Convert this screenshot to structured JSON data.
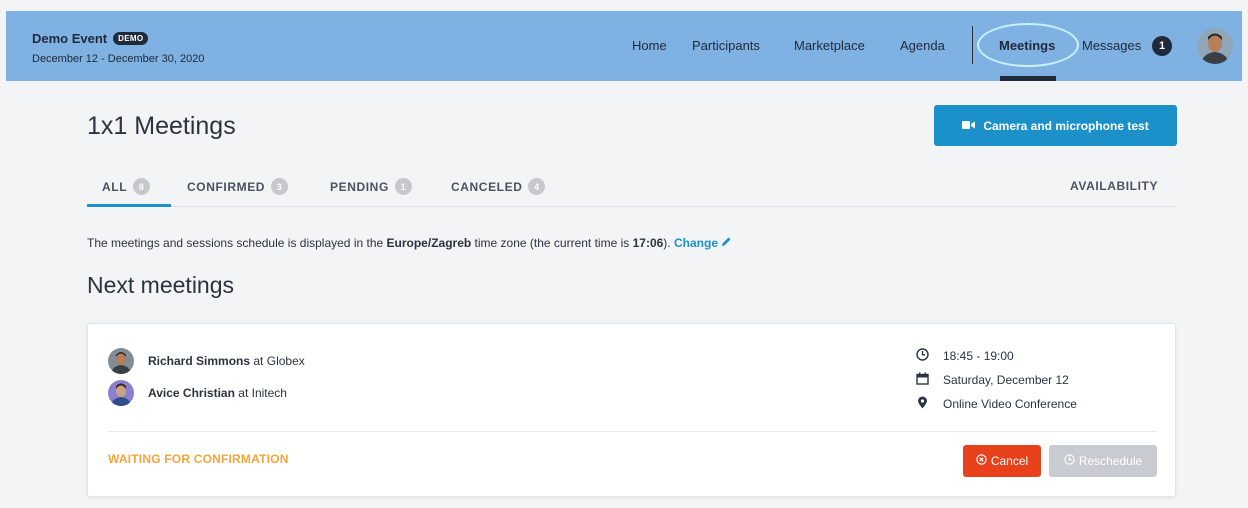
{
  "event": {
    "name": "Demo Event",
    "badge": "DEMO",
    "dates": "December 12 - December 30, 2020"
  },
  "nav": {
    "home": "Home",
    "participants": "Participants",
    "marketplace": "Marketplace",
    "agenda": "Agenda",
    "meetings": "Meetings",
    "messages": "Messages",
    "messages_count": "1"
  },
  "page": {
    "title": "1x1 Meetings",
    "camera_button": "Camera and microphone test"
  },
  "tabs": [
    {
      "label": "ALL",
      "count": "8"
    },
    {
      "label": "CONFIRMED",
      "count": "3"
    },
    {
      "label": "PENDING",
      "count": "1"
    },
    {
      "label": "CANCELED",
      "count": "4"
    }
  ],
  "availability": "AVAILABILITY",
  "timezone": {
    "prefix": "The meetings and sessions schedule is displayed in the ",
    "zone": "Europe/Zagreb",
    "middle": " time zone (the current time is ",
    "time": "17:06",
    "suffix": ").",
    "change": "Change"
  },
  "section_title": "Next meetings",
  "meeting": {
    "participants": [
      {
        "name": "Richard Simmons",
        "at": "at",
        "company": "Globex"
      },
      {
        "name": "Avice Christian",
        "at": "at",
        "company": "Initech"
      }
    ],
    "time": "18:45 - 19:00",
    "date": "Saturday, December 12",
    "location": "Online Video Conference",
    "status": "WAITING FOR CONFIRMATION",
    "cancel": "Cancel",
    "reschedule": "Reschedule"
  },
  "colors": {
    "header": "#7fb1e3",
    "accent": "#1c90c8",
    "cancel": "#e8421d",
    "status_pending": "#f5a53a"
  }
}
